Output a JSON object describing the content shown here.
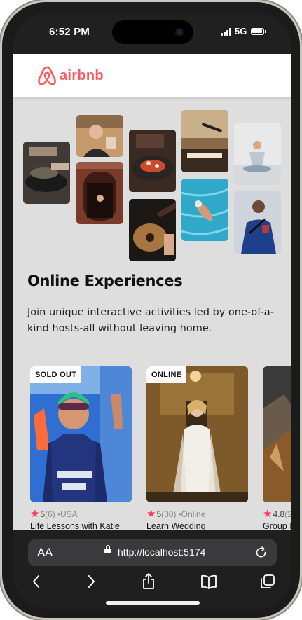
{
  "status_bar": {
    "time": "6:52 PM",
    "network": "5G"
  },
  "app": {
    "logo_text": "airbnb",
    "brand_color": "#ff5a5f"
  },
  "hero": {
    "title": "Online Experiences",
    "description": "Join unique interactive activities led by one-of-a-kind hosts-all without leaving home."
  },
  "experiences": [
    {
      "badge": "SOLD OUT",
      "rating": "5",
      "reviews": "(6)",
      "location": "•USA",
      "name": "Life Lessons with Katie"
    },
    {
      "badge": "ONLINE",
      "rating": "5",
      "reviews": "(30)",
      "location": "•Online",
      "name": "Learn Wedding"
    },
    {
      "badge": "",
      "rating": "4.8",
      "reviews": "(2",
      "location": "",
      "name": "Group I"
    }
  ],
  "browser": {
    "text_size_label": "AA",
    "url": "http://localhost:5174"
  },
  "icons": {
    "back": "chevron-left-icon",
    "forward": "chevron-right-icon",
    "share": "share-icon",
    "bookmarks": "book-icon",
    "tabs": "tabs-icon",
    "reload": "reload-icon",
    "lock": "lock-icon"
  },
  "colors": {
    "star": "#ff385c",
    "page_bg": "#dedede",
    "browser_bg": "#1f1f1f"
  }
}
